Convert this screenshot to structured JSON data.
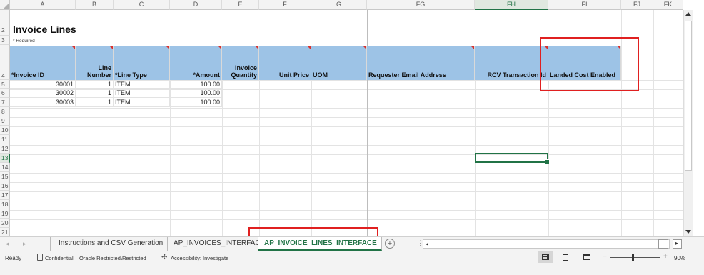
{
  "columns": [
    "A",
    "B",
    "C",
    "D",
    "E",
    "F",
    "G",
    "FG",
    "FH",
    "FI",
    "FJ",
    "FK"
  ],
  "active_column": "FH",
  "rows": [
    "2",
    "3",
    "4",
    "5",
    "6",
    "7",
    "8",
    "9",
    "10",
    "11",
    "12",
    "13",
    "14",
    "15",
    "16",
    "17",
    "18",
    "19",
    "20",
    "21"
  ],
  "active_row": "13",
  "sheet": {
    "title": "Invoice Lines",
    "required_note": "* Required",
    "headers": {
      "invoice_id": "*Invoice ID",
      "line_number_1": "Line",
      "line_number_2": "Number",
      "line_type": "*Line Type",
      "amount": "*Amount",
      "invoice_quantity_1": "Invoice",
      "invoice_quantity_2": "Quantity",
      "unit_price": "Unit Price",
      "uom": "UOM",
      "requester_email": "Requester Email Address",
      "rcv_transaction_id": "RCV Transaction Id",
      "landed_cost_enabled": "Landed Cost Enabled"
    },
    "data_rows": [
      {
        "invoice_id": "30001",
        "line_number": "1",
        "line_type": "ITEM",
        "amount": "100.00"
      },
      {
        "invoice_id": "30002",
        "line_number": "1",
        "line_type": "ITEM",
        "amount": "100.00"
      },
      {
        "invoice_id": "30003",
        "line_number": "1",
        "line_type": "ITEM",
        "amount": "100.00"
      }
    ]
  },
  "tabs": {
    "instructions": "Instructions and CSV Generation",
    "invoices_interface": "AP_INVOICES_INTERFACE",
    "invoice_lines_interface": "AP_INVOICE_LINES_INTERFACE",
    "add_sheet": "+"
  },
  "status": {
    "ready": "Ready",
    "sensitivity": "Confidential – Oracle Restricted\\Restricted",
    "accessibility": "Accessibility: Investigate",
    "zoom": "90%"
  },
  "colors": {
    "header_fill": "#9dc3e6",
    "accent_green": "#217346",
    "annotation_red": "#e02020"
  }
}
